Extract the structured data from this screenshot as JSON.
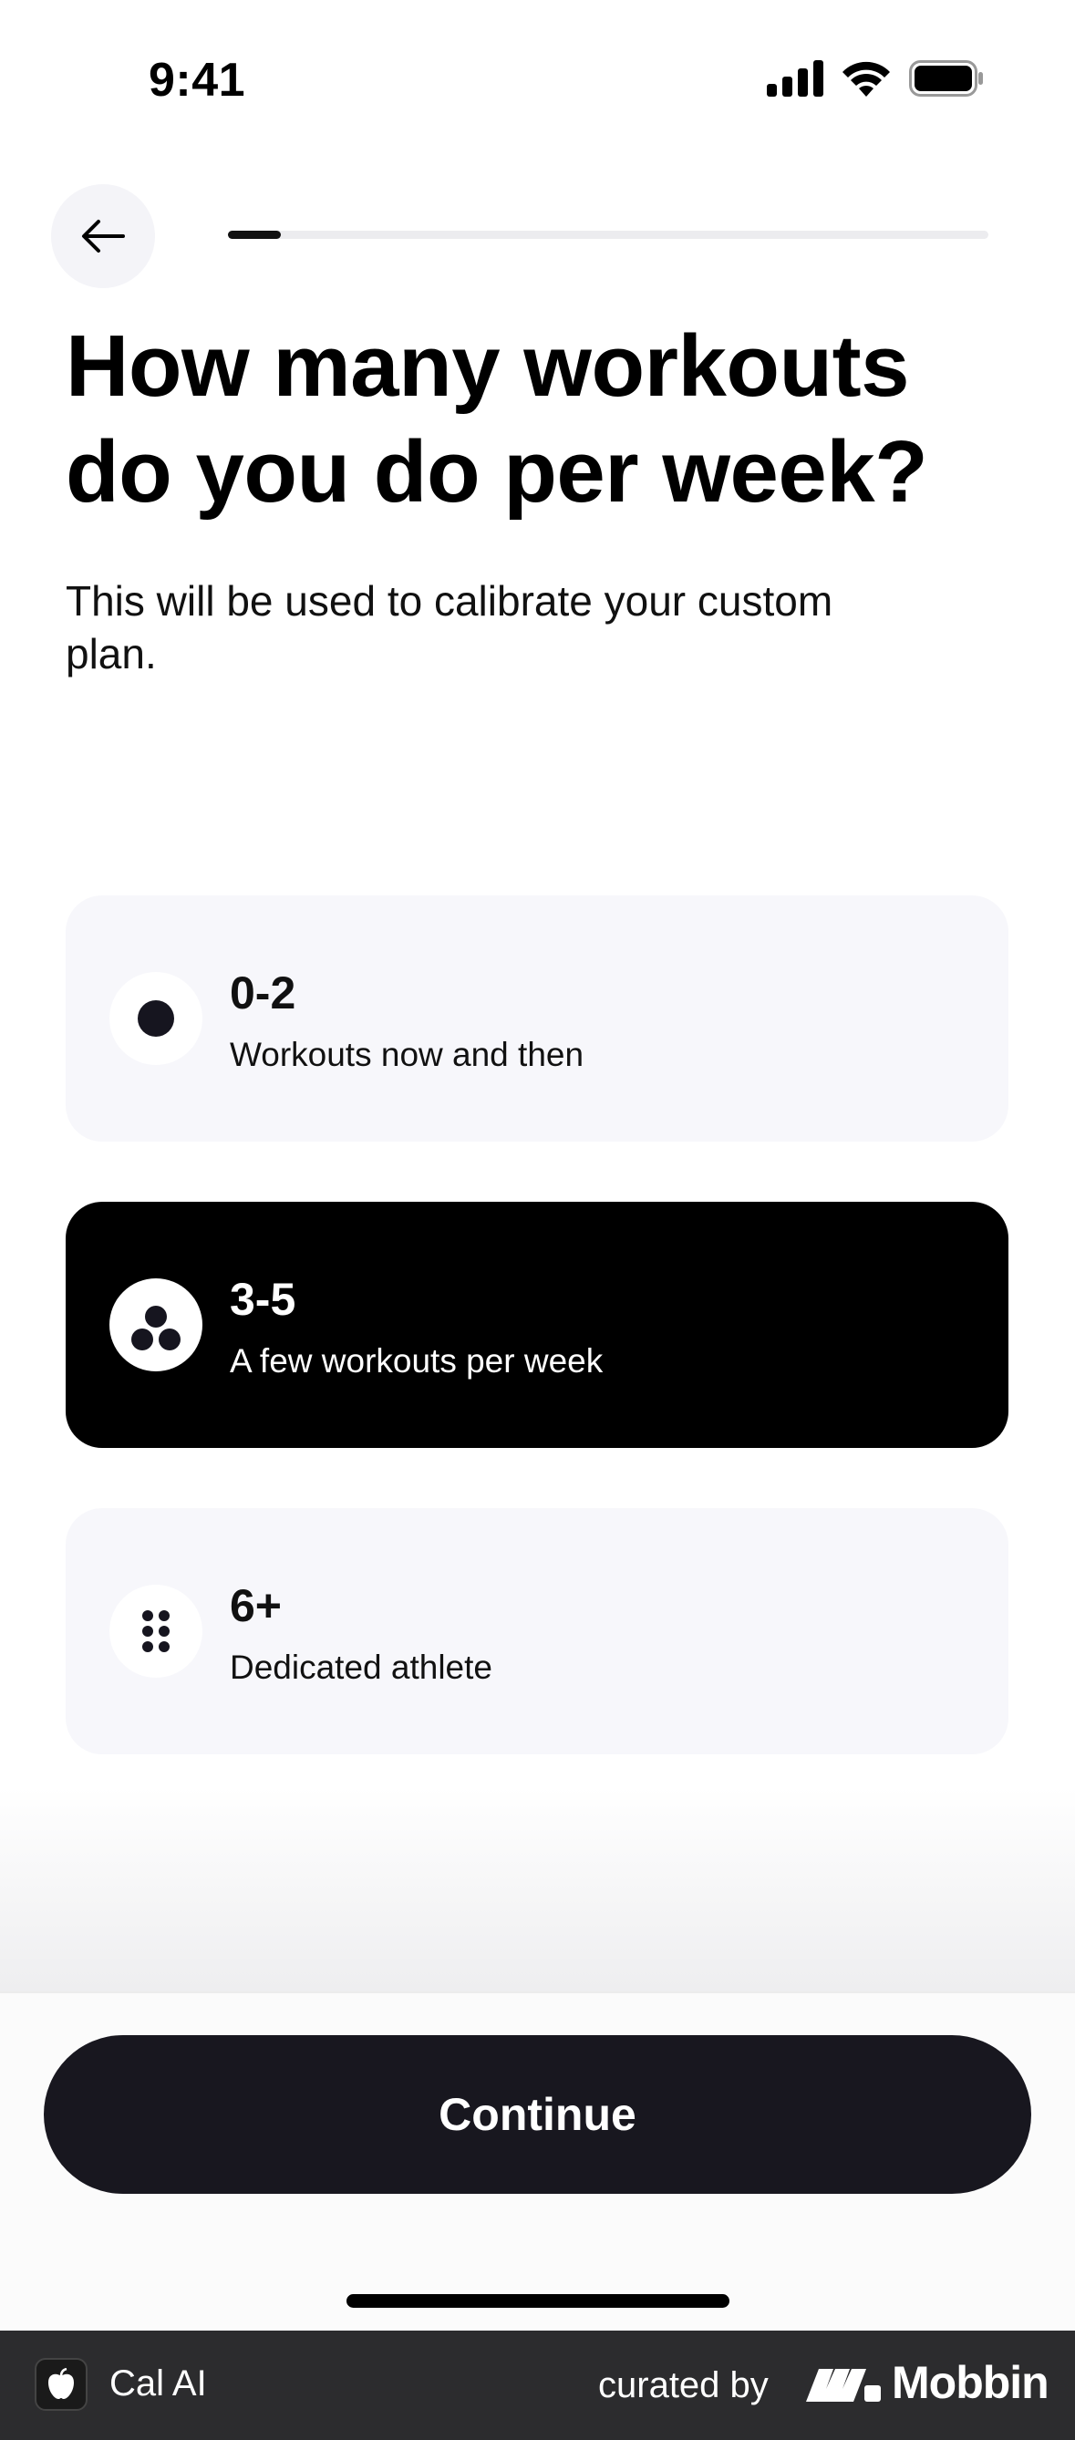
{
  "status_bar": {
    "time": "9:41",
    "icons": [
      "signal-icon",
      "wifi-icon",
      "battery-icon"
    ]
  },
  "header": {
    "back_icon": "arrow-left-icon",
    "progress": 0.07
  },
  "title": "How many workouts do you do per week?",
  "subtitle": "This will be used to calibrate your custom plan.",
  "options": [
    {
      "value": "0-2",
      "description": "Workouts now and then",
      "icon": "one-dot-icon",
      "selected": false
    },
    {
      "value": "3-5",
      "description": "A few workouts per week",
      "icon": "three-dots-icon",
      "selected": true
    },
    {
      "value": "6+",
      "description": "Dedicated athlete",
      "icon": "six-dots-icon",
      "selected": false
    }
  ],
  "continue_label": "Continue",
  "footer": {
    "app_name": "Cal AI",
    "curated_label": "curated by",
    "brand": "Mobbin"
  },
  "colors": {
    "selected_bg": "#000000",
    "option_bg": "#f7f7fb",
    "button_bg": "#18171f"
  }
}
